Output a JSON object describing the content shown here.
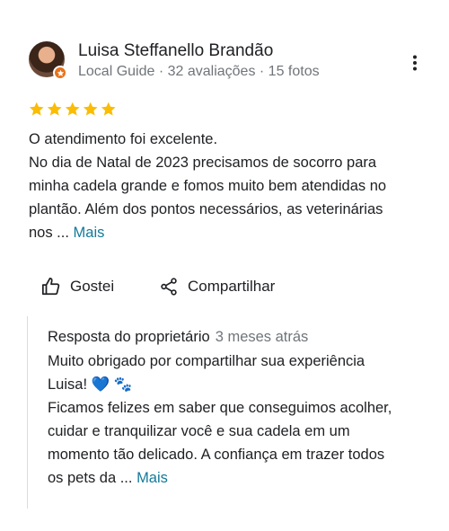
{
  "review": {
    "author": {
      "name": "Luisa Steffanello Brandão",
      "meta": "Local Guide · 32 avaliações · 15 fotos",
      "avatar_icon": "user-photo",
      "badge_icon": "local-guide-star-icon"
    },
    "rating": 5,
    "max_rating": 5,
    "star_color": "#fbbc04",
    "text_lines": [
      "O atendimento foi excelente.",
      "No dia de Natal de 2023 precisamos de socorro para",
      "minha cadela grande e fomos muito bem atendidas no",
      "plantão. Além dos pontos necessários, as veterinárias",
      "nos ... "
    ],
    "more_label": "Mais",
    "actions": {
      "like_label": "Gostei",
      "share_label": "Compartilhar"
    },
    "owner_response": {
      "title": "Resposta do proprietário",
      "date": "3 meses atrás",
      "lines": [
        "Muito obrigado por compartilhar sua experiência",
        "Luisa! 💙 🐾",
        "Ficamos felizes em saber que conseguimos acolher,",
        "cuidar e tranquilizar você e sua cadela em um",
        "momento tão delicado. A confiança em trazer todos",
        "os pets da ... "
      ],
      "more_label": "Mais"
    },
    "link_color": "#137a9a"
  }
}
